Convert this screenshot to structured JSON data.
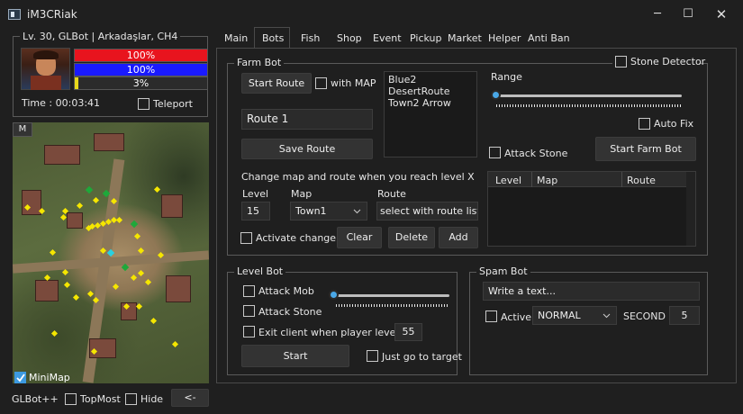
{
  "window": {
    "title": "iM3CRiak",
    "minimize": "─",
    "maximize": "☐",
    "close": "✕"
  },
  "status": {
    "group_title": "Lv. 30, GLBot | Arkadaşlar, CH4",
    "hp_text": "100%",
    "hp_value": 1.0,
    "mp_text": "100%",
    "mp_value": 1.0,
    "exp_text": "3%",
    "exp_value": 0.03,
    "time": "Time : 00:03:41",
    "teleport_label": "Teleport"
  },
  "minimap": {
    "m_button": "M",
    "checkbox_label": "MiniMap",
    "checked": true
  },
  "bottom": {
    "brand": "GLBot++",
    "topmost_label": "TopMost",
    "hide_label": "Hide",
    "arrow_button": "<-"
  },
  "tabs": [
    "Main",
    "Bots",
    "Fish",
    "Shop",
    "Event",
    "Pickup",
    "Market",
    "Helper",
    "Anti Ban"
  ],
  "active_tab": "Bots",
  "farm": {
    "title": "Farm Bot",
    "start_route": "Start Route",
    "with_map_label": "with MAP",
    "routes": [
      "Blue2",
      "DesertRoute",
      "Town2 Arrow"
    ],
    "route_name": "Route 1",
    "save_route": "Save Route",
    "range_label": "Range",
    "range_value": 0.0,
    "auto_fix_label": "Auto Fix",
    "attack_stone_label": "Attack Stone",
    "start_farm_bot": "Start Farm Bot",
    "stone_detector_label": "Stone Detector",
    "change_text": "Change map and route when you reach level X",
    "level_label": "Level",
    "map_label": "Map",
    "route_label": "Route",
    "level_value": "15",
    "map_value": "Town1",
    "route_value": "select with route list",
    "activate_changer_label": "Activate changer",
    "clear": "Clear",
    "delete": "Delete",
    "add": "Add",
    "columns": [
      "Level",
      "Map",
      "Route"
    ]
  },
  "level_bot": {
    "title": "Level Bot",
    "attack_mob_label": "Attack Mob",
    "attack_stone_label": "Attack Stone",
    "exit_label": "Exit client when player level is",
    "exit_level": "55",
    "slider_value": 0.0,
    "start": "Start",
    "just_go_label": "Just go to target"
  },
  "spam_bot": {
    "title": "Spam Bot",
    "text_value": "Write a text...",
    "active_label": "Active",
    "mode_value": "NORMAL",
    "second_label": "SECOND :",
    "second_value": "5"
  },
  "colors": {
    "hp": "#e8141e",
    "mp": "#1a1aff",
    "exp": "#e8d81a",
    "accent": "#3d9ae0"
  }
}
